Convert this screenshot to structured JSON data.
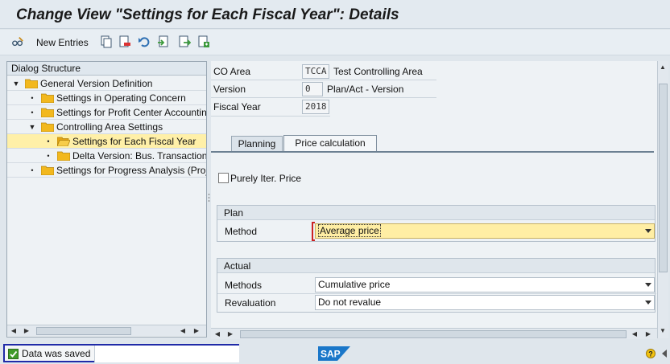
{
  "window": {
    "title": "Change View \"Settings for Each Fiscal Year\": Details"
  },
  "toolbar": {
    "new_entries_label": "New Entries",
    "icons": [
      "glasses-edit-icon",
      "copy-icon",
      "delete-icon",
      "undo-icon",
      "select-all-icon",
      "export-icon",
      "configure-icon"
    ]
  },
  "dialog_structure": {
    "header": "Dialog Structure",
    "items": [
      {
        "label": "General Version Definition",
        "level": 0,
        "expanded": true
      },
      {
        "label": "Settings in Operating Concern",
        "level": 1
      },
      {
        "label": "Settings for Profit Center Accounting",
        "level": 1
      },
      {
        "label": "Controlling Area Settings",
        "level": 1,
        "expanded": true
      },
      {
        "label": "Settings for Each Fiscal Year",
        "level": 2,
        "selected": true
      },
      {
        "label": "Delta Version: Bus. Transactions",
        "level": 2
      },
      {
        "label": "Settings for Progress Analysis (Project)",
        "level": 1
      }
    ]
  },
  "header_fields": {
    "co_area": {
      "label": "CO Area",
      "value": "TCCA",
      "description": "Test Controlling Area"
    },
    "version": {
      "label": "Version",
      "value": "0",
      "description": "Plan/Act - Version"
    },
    "fiscal_year": {
      "label": "Fiscal Year",
      "value": "2018"
    }
  },
  "tabs": [
    {
      "label": "Planning",
      "active": false
    },
    {
      "label": "Price calculation",
      "active": true
    }
  ],
  "price_calc": {
    "purely_iter_price": {
      "label": "Purely Iter. Price",
      "checked": false
    },
    "plan": {
      "title": "Plan",
      "method_label": "Method",
      "method_value": "Average price"
    },
    "actual": {
      "title": "Actual",
      "methods_label": "Methods",
      "methods_value": "Cumulative price",
      "revaluation_label": "Revaluation",
      "revaluation_value": "Do not revalue"
    }
  },
  "status": {
    "message": "Data was saved",
    "type": "success"
  },
  "colors": {
    "title_bg": "#e3eaf0",
    "panel_bg": "#eef2f5",
    "selected_bg": "#fff0a8",
    "focus_field_bg": "#ffeea4",
    "status_border": "#1f2aa8",
    "success_green": "#3f9a2a",
    "sap_blue": "#1a77c9",
    "folder_yellow": "#f2b81e"
  }
}
